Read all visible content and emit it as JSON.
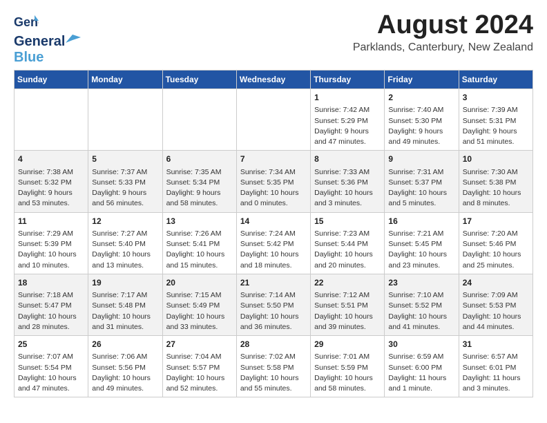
{
  "header": {
    "logo_line1": "General",
    "logo_line2": "Blue",
    "title": "August 2024",
    "subtitle": "Parklands, Canterbury, New Zealand"
  },
  "calendar": {
    "days_of_week": [
      "Sunday",
      "Monday",
      "Tuesday",
      "Wednesday",
      "Thursday",
      "Friday",
      "Saturday"
    ],
    "weeks": [
      [
        {
          "day": "",
          "info": ""
        },
        {
          "day": "",
          "info": ""
        },
        {
          "day": "",
          "info": ""
        },
        {
          "day": "",
          "info": ""
        },
        {
          "day": "1",
          "info": "Sunrise: 7:42 AM\nSunset: 5:29 PM\nDaylight: 9 hours\nand 47 minutes."
        },
        {
          "day": "2",
          "info": "Sunrise: 7:40 AM\nSunset: 5:30 PM\nDaylight: 9 hours\nand 49 minutes."
        },
        {
          "day": "3",
          "info": "Sunrise: 7:39 AM\nSunset: 5:31 PM\nDaylight: 9 hours\nand 51 minutes."
        }
      ],
      [
        {
          "day": "4",
          "info": "Sunrise: 7:38 AM\nSunset: 5:32 PM\nDaylight: 9 hours\nand 53 minutes."
        },
        {
          "day": "5",
          "info": "Sunrise: 7:37 AM\nSunset: 5:33 PM\nDaylight: 9 hours\nand 56 minutes."
        },
        {
          "day": "6",
          "info": "Sunrise: 7:35 AM\nSunset: 5:34 PM\nDaylight: 9 hours\nand 58 minutes."
        },
        {
          "day": "7",
          "info": "Sunrise: 7:34 AM\nSunset: 5:35 PM\nDaylight: 10 hours\nand 0 minutes."
        },
        {
          "day": "8",
          "info": "Sunrise: 7:33 AM\nSunset: 5:36 PM\nDaylight: 10 hours\nand 3 minutes."
        },
        {
          "day": "9",
          "info": "Sunrise: 7:31 AM\nSunset: 5:37 PM\nDaylight: 10 hours\nand 5 minutes."
        },
        {
          "day": "10",
          "info": "Sunrise: 7:30 AM\nSunset: 5:38 PM\nDaylight: 10 hours\nand 8 minutes."
        }
      ],
      [
        {
          "day": "11",
          "info": "Sunrise: 7:29 AM\nSunset: 5:39 PM\nDaylight: 10 hours\nand 10 minutes."
        },
        {
          "day": "12",
          "info": "Sunrise: 7:27 AM\nSunset: 5:40 PM\nDaylight: 10 hours\nand 13 minutes."
        },
        {
          "day": "13",
          "info": "Sunrise: 7:26 AM\nSunset: 5:41 PM\nDaylight: 10 hours\nand 15 minutes."
        },
        {
          "day": "14",
          "info": "Sunrise: 7:24 AM\nSunset: 5:42 PM\nDaylight: 10 hours\nand 18 minutes."
        },
        {
          "day": "15",
          "info": "Sunrise: 7:23 AM\nSunset: 5:44 PM\nDaylight: 10 hours\nand 20 minutes."
        },
        {
          "day": "16",
          "info": "Sunrise: 7:21 AM\nSunset: 5:45 PM\nDaylight: 10 hours\nand 23 minutes."
        },
        {
          "day": "17",
          "info": "Sunrise: 7:20 AM\nSunset: 5:46 PM\nDaylight: 10 hours\nand 25 minutes."
        }
      ],
      [
        {
          "day": "18",
          "info": "Sunrise: 7:18 AM\nSunset: 5:47 PM\nDaylight: 10 hours\nand 28 minutes."
        },
        {
          "day": "19",
          "info": "Sunrise: 7:17 AM\nSunset: 5:48 PM\nDaylight: 10 hours\nand 31 minutes."
        },
        {
          "day": "20",
          "info": "Sunrise: 7:15 AM\nSunset: 5:49 PM\nDaylight: 10 hours\nand 33 minutes."
        },
        {
          "day": "21",
          "info": "Sunrise: 7:14 AM\nSunset: 5:50 PM\nDaylight: 10 hours\nand 36 minutes."
        },
        {
          "day": "22",
          "info": "Sunrise: 7:12 AM\nSunset: 5:51 PM\nDaylight: 10 hours\nand 39 minutes."
        },
        {
          "day": "23",
          "info": "Sunrise: 7:10 AM\nSunset: 5:52 PM\nDaylight: 10 hours\nand 41 minutes."
        },
        {
          "day": "24",
          "info": "Sunrise: 7:09 AM\nSunset: 5:53 PM\nDaylight: 10 hours\nand 44 minutes."
        }
      ],
      [
        {
          "day": "25",
          "info": "Sunrise: 7:07 AM\nSunset: 5:54 PM\nDaylight: 10 hours\nand 47 minutes."
        },
        {
          "day": "26",
          "info": "Sunrise: 7:06 AM\nSunset: 5:56 PM\nDaylight: 10 hours\nand 49 minutes."
        },
        {
          "day": "27",
          "info": "Sunrise: 7:04 AM\nSunset: 5:57 PM\nDaylight: 10 hours\nand 52 minutes."
        },
        {
          "day": "28",
          "info": "Sunrise: 7:02 AM\nSunset: 5:58 PM\nDaylight: 10 hours\nand 55 minutes."
        },
        {
          "day": "29",
          "info": "Sunrise: 7:01 AM\nSunset: 5:59 PM\nDaylight: 10 hours\nand 58 minutes."
        },
        {
          "day": "30",
          "info": "Sunrise: 6:59 AM\nSunset: 6:00 PM\nDaylight: 11 hours\nand 1 minute."
        },
        {
          "day": "31",
          "info": "Sunrise: 6:57 AM\nSunset: 6:01 PM\nDaylight: 11 hours\nand 3 minutes."
        }
      ]
    ]
  }
}
